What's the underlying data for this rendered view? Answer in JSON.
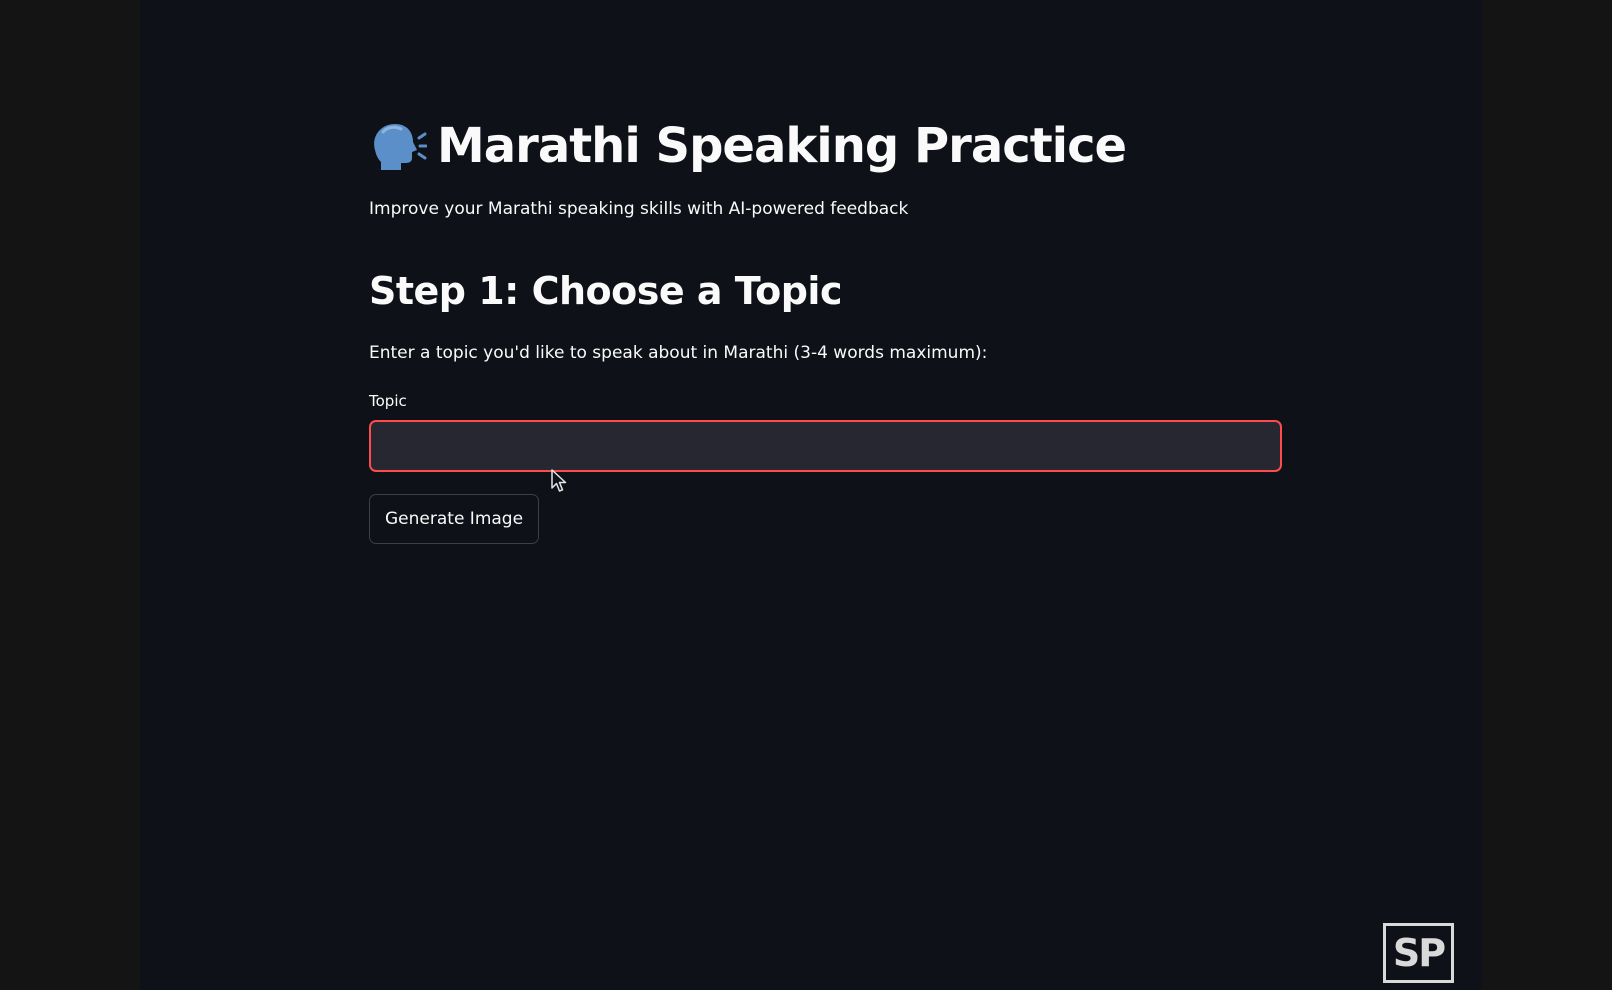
{
  "header": {
    "title": "Marathi Speaking Practice",
    "subtitle": "Improve your Marathi speaking skills with AI-powered feedback",
    "icon": "speaking-head-icon"
  },
  "step1": {
    "heading": "Step 1: Choose a Topic",
    "instruction": "Enter a topic you'd like to speak about in Marathi (3-4 words maximum):",
    "field_label": "Topic",
    "input_value": "",
    "button_label": "Generate Image"
  },
  "watermark": {
    "text": "SP"
  },
  "colors": {
    "background": "#0e1117",
    "text": "#fafafa",
    "input_background": "#262730",
    "input_focus_border": "#ff4b4b",
    "button_border": "#3d3f47"
  }
}
